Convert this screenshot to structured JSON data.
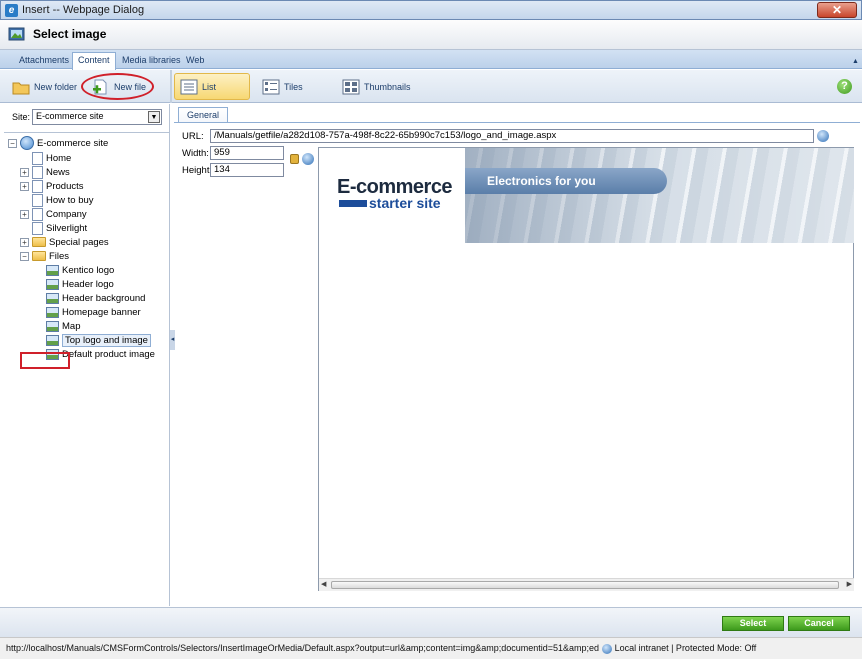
{
  "window": {
    "title": "Insert -- Webpage Dialog",
    "close_label": "✕"
  },
  "header": {
    "title": "Select image"
  },
  "tabs": [
    {
      "label": "Attachments"
    },
    {
      "label": "Content"
    },
    {
      "label": "Media libraries"
    },
    {
      "label": "Web"
    }
  ],
  "toolbar": {
    "new_folder": "New folder",
    "new_file": "New file",
    "list": "List",
    "tiles": "Tiles",
    "thumbnails": "Thumbnails",
    "help": "?"
  },
  "site": {
    "label": "Site:",
    "value": "E-commerce site"
  },
  "tree": {
    "root": "E-commerce site",
    "items": [
      "Home",
      "News",
      "Products",
      "How to buy",
      "Company",
      "Silverlight",
      "Special pages",
      "Files",
      "Kentico logo",
      "Header logo",
      "Header background",
      "Homepage banner",
      "Map",
      "Top logo and image",
      "Default product image"
    ]
  },
  "properties": {
    "tab": "General",
    "url_label": "URL:",
    "url": "/Manuals/getfile/a282d108-757a-498f-8c22-65b990c7c153/logo_and_image.aspx",
    "width_label": "Width:",
    "width": "959",
    "height_label": "Height:",
    "height": "134"
  },
  "preview": {
    "logo_line1": "E-commerce",
    "logo_line2": "starter site",
    "tagline": "Electronics for you"
  },
  "buttons": {
    "select": "Select",
    "cancel": "Cancel"
  },
  "status": {
    "url": "http://localhost/Manuals/CMSFormControls/Selectors/InsertImageOrMedia/Default.aspx?output=url&amp;content=img&amp;documentid=51&amp;ed",
    "zone": "Local intranet | Protected Mode: Off"
  }
}
